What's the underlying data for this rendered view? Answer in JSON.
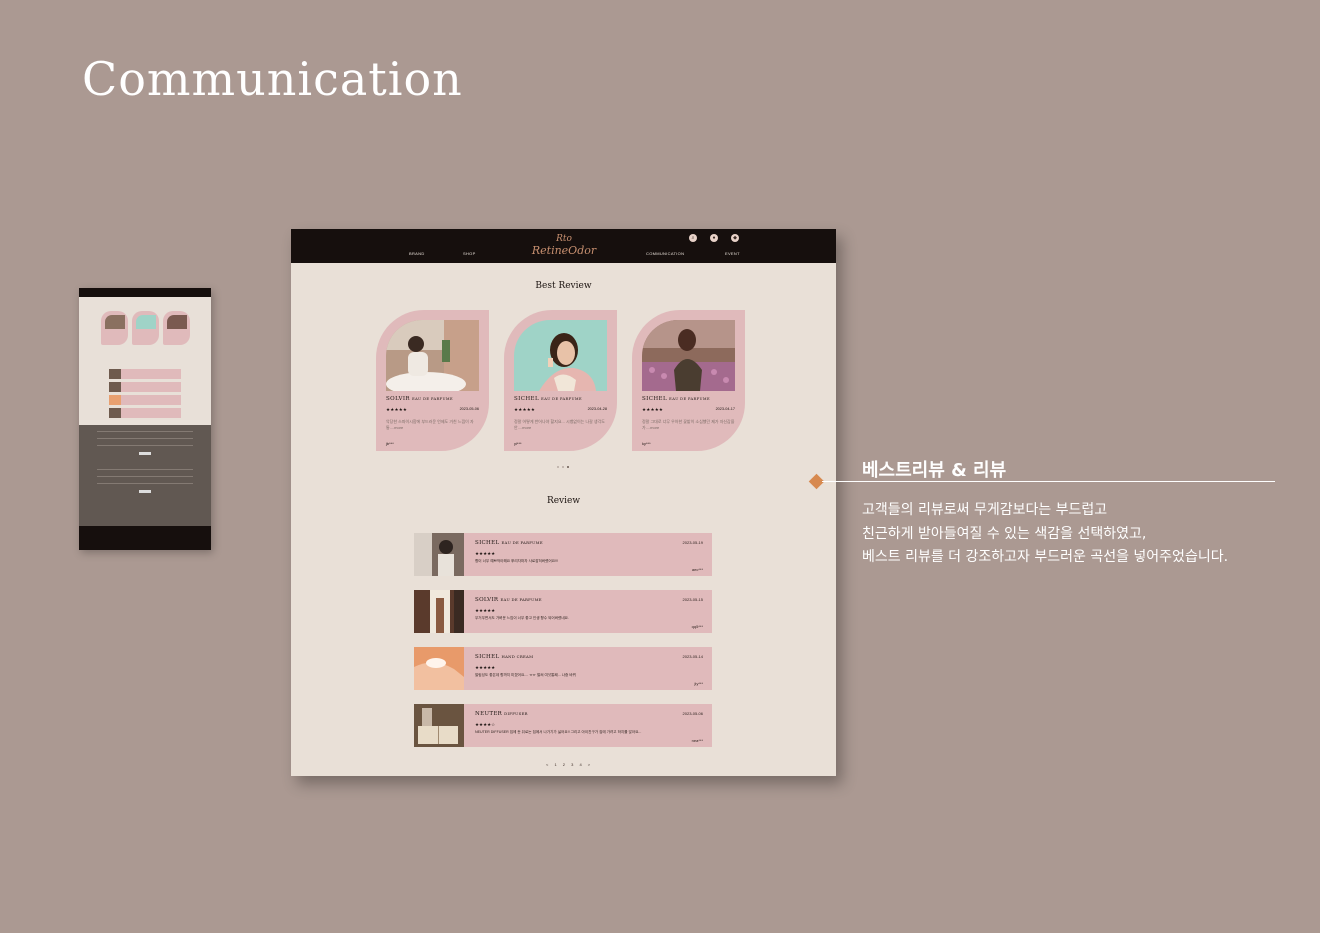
{
  "page": {
    "heading": "Communication"
  },
  "nav": {
    "brand": "BRAND",
    "shop": "SHOP",
    "logo_mark": "Rto",
    "logo": "RetineOdor",
    "communication": "COMMUNICATION",
    "event": "EVENT"
  },
  "best_review": {
    "title": "Best Review",
    "cards": [
      {
        "name": "SOLVIR",
        "type": "EAU DE PARFUME",
        "stars": "★★★★★",
        "date": "2023-05-06",
        "text": "악당한 스파이시함에 부드러운 언제도 거친 느낌이 자통....more",
        "user": "jb***"
      },
      {
        "name": "SICHEL",
        "type": "EAU DE PARFUME",
        "stars": "★★★★★",
        "date": "2023-04-28",
        "text": "정말 어떻게 반어나야 할지요... 시뱅없이는 나갈 생각도 안....more",
        "user": "yi***"
      },
      {
        "name": "SICHEL",
        "type": "EAU DE PARFUME",
        "stars": "★★★★★",
        "date": "2023-04-17",
        "text": "정말 그대로 너무 우아한 꽃밭이 소심했던 제가 자신감을 가....more",
        "user": "ky***"
      }
    ]
  },
  "review": {
    "title": "Review",
    "rows": [
      {
        "name": "SICHEL",
        "type": "EAU DE PARFUME",
        "stars": "★★★★★",
        "date": "2023-05-19",
        "text": "향이 너무 예쁘작아해요 뿌리자마자 사로잡혀버렸어요!!!",
        "user": "aec***"
      },
      {
        "name": "SOLVIR",
        "type": "EAU DE PARFUME",
        "stars": "★★★★★",
        "date": "2023-05-15",
        "text": "무거우면서도 가벼운 느낌이 너무 좋고 인생 향수 되어버렸네요.",
        "user": "qq5***"
      },
      {
        "name": "SICHEL",
        "type": "HAND CREAM",
        "stars": "★★★★★",
        "date": "2023-05-14",
        "text": "발림성도 좋은데 향까지 미쳤어요.... ㅠㅠ 벌써 여섯통째... 나중 바뀌",
        "user": "jiy***"
      },
      {
        "name": "NEUTER",
        "type": "DIFFUSER",
        "stars": "★★★★☆",
        "date": "2023-05-06",
        "text": "NEUTER DIFFUSER 집에 둔 뒤로는 집에서 나가기가 싫어요!! 그리고 아이친구가 집에 가려고 하지를 않아요...",
        "user": "nea***"
      }
    ],
    "pager": "< 1 2 3 4 >"
  },
  "annotation": {
    "title": "베스트리뷰 & 리뷰",
    "line1": "고객들의 리뷰로써 무게감보다는 부드럽고",
    "line2": "친근하게 받아들여질 수 있는 색감을 선택하였고,",
    "line3": "베스트 리뷰를 더 강조하고자 부드러운 곡선을 넣어주었습니다.",
    "accent_color": "#d7894f"
  }
}
